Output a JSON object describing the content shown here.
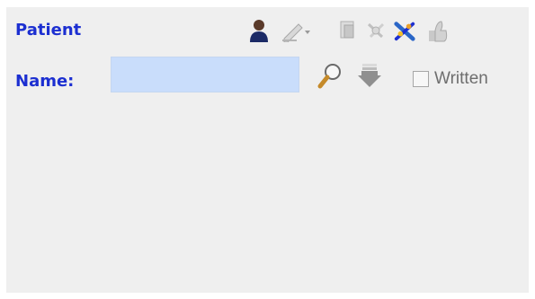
{
  "patient": {
    "section_title": "Patient",
    "name_label": "Name:",
    "name_value": "",
    "written_label": "Written",
    "written_checked": false
  },
  "toolbar": {
    "icons": [
      "person-icon",
      "edit-pen-icon",
      "document-icon",
      "disabled-tool-icon",
      "tools-icon",
      "thumbs-up-icon"
    ]
  },
  "colors": {
    "label": "#1c2fd1",
    "panel_bg": "#efefef",
    "input_bg": "#c9ddfb"
  }
}
